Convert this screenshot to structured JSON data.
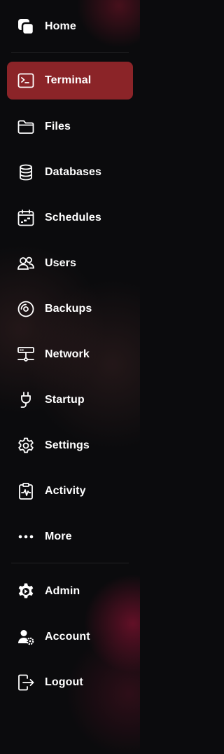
{
  "sidebar": {
    "items": [
      {
        "label": "Home",
        "icon": "home-icon"
      },
      {
        "label": "Terminal",
        "icon": "terminal-icon",
        "active": true
      },
      {
        "label": "Files",
        "icon": "folder-icon"
      },
      {
        "label": "Databases",
        "icon": "database-icon"
      },
      {
        "label": "Schedules",
        "icon": "calendar-icon"
      },
      {
        "label": "Users",
        "icon": "users-icon"
      },
      {
        "label": "Backups",
        "icon": "disc-icon"
      },
      {
        "label": "Network",
        "icon": "network-icon"
      },
      {
        "label": "Startup",
        "icon": "plug-icon"
      },
      {
        "label": "Settings",
        "icon": "gear-icon"
      },
      {
        "label": "Activity",
        "icon": "activity-clipboard-icon"
      },
      {
        "label": "More",
        "icon": "ellipsis-icon"
      }
    ],
    "bottom_items": [
      {
        "label": "Admin",
        "icon": "admin-gear-icon"
      },
      {
        "label": "Account",
        "icon": "user-cog-icon"
      },
      {
        "label": "Logout",
        "icon": "logout-icon"
      }
    ]
  },
  "colors": {
    "active_background": "#8b2428",
    "background": "#0b0b0d",
    "text": "#ffffff"
  }
}
